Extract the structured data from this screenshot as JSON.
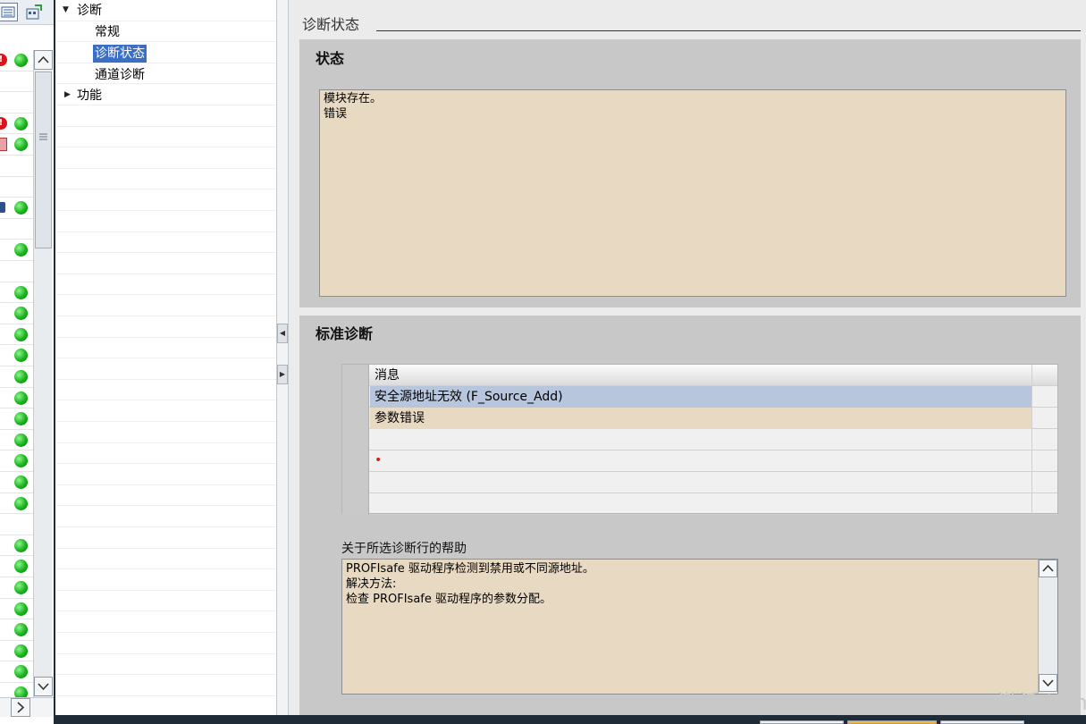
{
  "nav": {
    "root_label": "诊断",
    "items": [
      "常规",
      "诊断状态",
      "通道诊断"
    ],
    "selected_index": 1,
    "collapsed_label": "功能"
  },
  "main": {
    "section_title": "诊断状态",
    "status_panel": {
      "title": "状态",
      "lines": [
        "模块存在。",
        "错误"
      ]
    },
    "standard_panel": {
      "title": "标准诊断",
      "table_header": "消息",
      "rows": [
        "安全源地址无效 (F_Source_Add)",
        "参数错误",
        "",
        "",
        "",
        ""
      ],
      "help_label": "关于所选诊断行的帮助",
      "help_lines": [
        "PROFIsafe 驱动程序检测到禁用或不同源地址。",
        "解决方法:",
        "检查 PROFIsafe 驱动程序的参数分配。"
      ]
    }
  },
  "watermark": "激活 Win",
  "left_strip": {
    "rows": [
      {
        "err": "!",
        "dot": true
      },
      {
        "dot": false
      },
      {
        "dot": false
      },
      {
        "err": "!",
        "dot": true
      },
      {
        "err_sq": true,
        "dot": true
      },
      {
        "dot": false
      },
      {
        "dot": false
      },
      {
        "lock": true,
        "dot": true
      },
      {
        "dot": false
      },
      {
        "dot": true
      },
      {
        "dot": false
      },
      {
        "dot": true
      },
      {
        "dot": true
      },
      {
        "dot": true
      },
      {
        "dot": true
      },
      {
        "dot": true
      },
      {
        "dot": true
      },
      {
        "dot": true
      },
      {
        "dot": true
      },
      {
        "dot": true
      },
      {
        "dot": true
      },
      {
        "dot": true
      },
      {
        "dot": false
      },
      {
        "dot": true
      },
      {
        "dot": true
      },
      {
        "dot": true
      },
      {
        "dot": true
      },
      {
        "dot": true
      },
      {
        "dot": true
      },
      {
        "dot": true
      },
      {
        "dot": true
      }
    ]
  }
}
